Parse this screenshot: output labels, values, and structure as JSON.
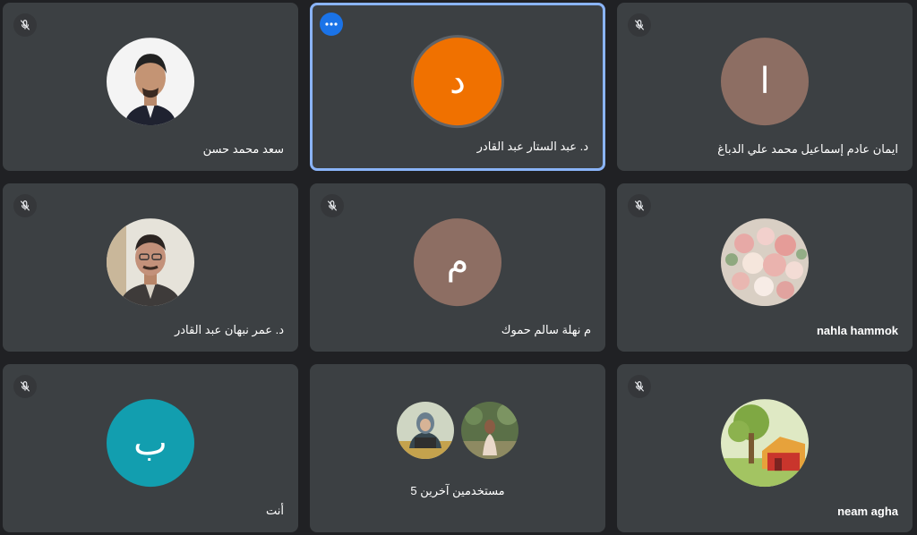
{
  "tiles": [
    {
      "name": "سعد محمد حسن",
      "type": "photo",
      "muted": true
    },
    {
      "name": "د. عبد الستار عبد القادر",
      "type": "letter",
      "letter": "د",
      "bg": "#f07100",
      "active": true
    },
    {
      "name": "ايمان عادم إسماعيل محمد علي الدباغ",
      "type": "letter",
      "letter": "ا",
      "bg": "#8d6e63",
      "muted": true
    },
    {
      "name": "د. عمر نبهان عبد القادر",
      "type": "photo",
      "muted": true
    },
    {
      "name": "م نهلة سالم حموك",
      "type": "letter",
      "letter": "م",
      "bg": "#8d6e63",
      "muted": true
    },
    {
      "name": "nahla hammok",
      "type": "photo",
      "muted": true
    },
    {
      "name": "أنت",
      "type": "letter",
      "letter": "ب",
      "bg": "#129eaf",
      "muted": true
    },
    {
      "label": "5 مستخدمين آخرين",
      "type": "group"
    },
    {
      "name": "neam agha",
      "type": "photo",
      "muted": true
    }
  ],
  "colors": {
    "background": "#202124",
    "tile": "#3c4043",
    "active_border": "#8ab4f8",
    "menu_button": "#1a73e8"
  },
  "icons": {
    "muted": "mic-off-icon",
    "menu": "more-options-icon"
  }
}
